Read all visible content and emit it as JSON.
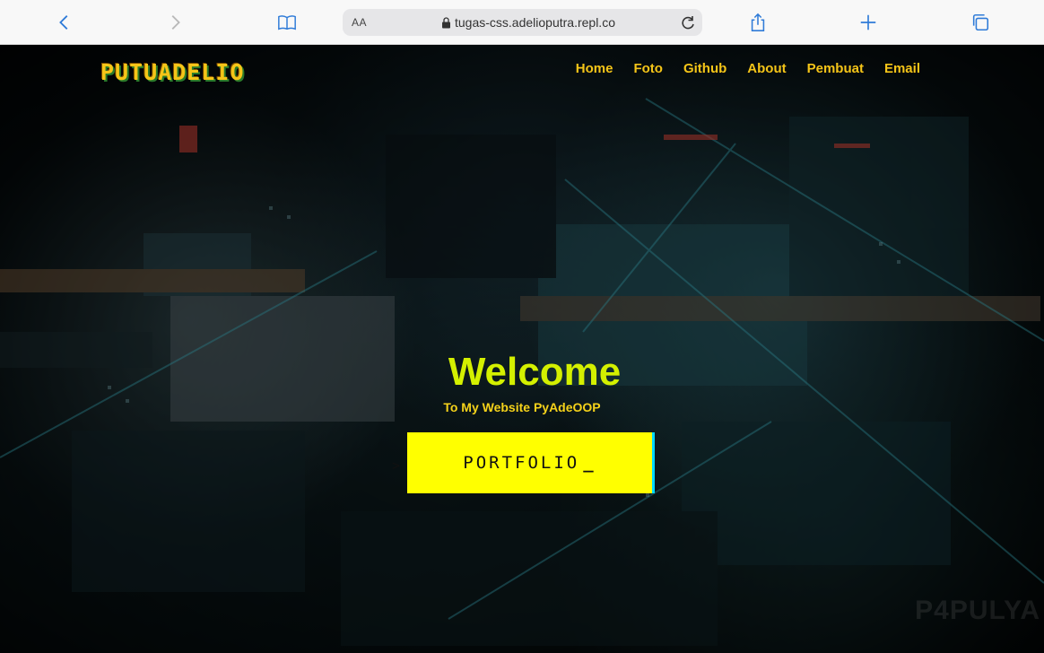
{
  "browser": {
    "reader_label": "AA",
    "url": "tugas-css.adelioputra.repl.co",
    "icons": [
      "back-icon",
      "forward-icon",
      "bookmarks-icon",
      "lock-icon",
      "reload-icon",
      "share-icon",
      "new-tab-icon",
      "tabs-icon"
    ]
  },
  "site": {
    "logo": "PUTUADELIO",
    "nav": [
      "Home",
      "Foto",
      "Github",
      "About",
      "Pembuat",
      "Email"
    ],
    "hero_title": "Welcome",
    "hero_subtitle": "To My Website PyAdeOOP",
    "button_label": "PORTFOLIO",
    "button_cursor": "_",
    "button_prompt": ">",
    "watermark": "P4PULYA"
  },
  "colors": {
    "accent_yellow": "#ffff00",
    "title_green": "#d4f000",
    "nav_gold": "#f5c518",
    "button_edge": "#00d8ff"
  }
}
